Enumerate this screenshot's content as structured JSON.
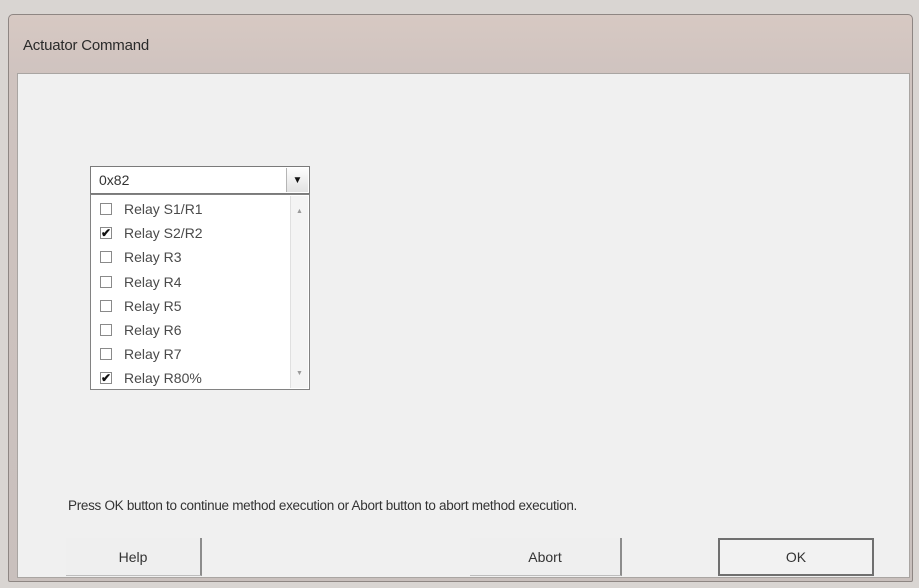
{
  "window": {
    "title": "Actuator Command"
  },
  "combo": {
    "value": "0x82",
    "arrow_icon": "triangle-down"
  },
  "list": {
    "items": [
      {
        "label": "Relay S1/R1",
        "checked": false
      },
      {
        "label": "Relay S2/R2",
        "checked": true
      },
      {
        "label": "Relay R3",
        "checked": false
      },
      {
        "label": "Relay R4",
        "checked": false
      },
      {
        "label": "Relay R5",
        "checked": false
      },
      {
        "label": "Relay R6",
        "checked": false
      },
      {
        "label": "Relay R7",
        "checked": false
      },
      {
        "label": "Relay R80%",
        "checked": true
      }
    ]
  },
  "message": "Press OK button to continue method execution or Abort button to abort method execution.",
  "buttons": {
    "help": "Help",
    "abort": "Abort",
    "ok": "OK"
  }
}
